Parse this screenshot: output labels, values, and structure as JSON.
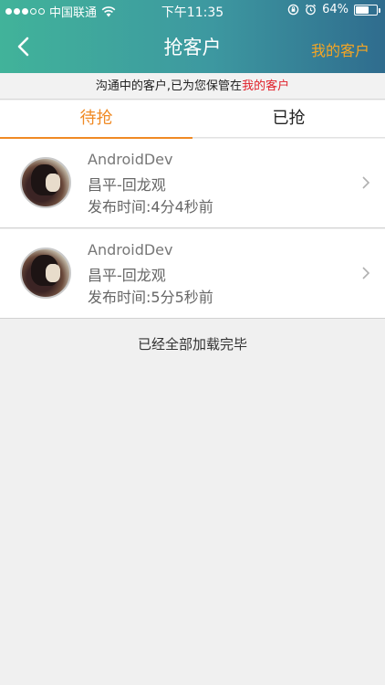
{
  "status_bar": {
    "carrier": "中国联通",
    "time": "下午11:35",
    "battery": "64%",
    "battery_level": 0.64
  },
  "nav": {
    "title": "抢客户",
    "right_label": "我的客户",
    "back_icon": "chevron-left-icon"
  },
  "notice": {
    "prefix": "沟通中的客户,已为您保管在",
    "link": "我的客户"
  },
  "tabs": [
    {
      "label": "待抢",
      "active": true
    },
    {
      "label": "已抢",
      "active": false
    }
  ],
  "customers": [
    {
      "name": "AndroidDev",
      "location": "昌平-回龙观",
      "publish_time": "发布时间:4分4秒前"
    },
    {
      "name": "AndroidDev",
      "location": "昌平-回龙观",
      "publish_time": "发布时间:5分5秒前"
    }
  ],
  "list_end": "已经全部加载完毕",
  "colors": {
    "header_start": "#41b39a",
    "header_end": "#2f6c8e",
    "accent_orange": "#f08a24",
    "nav_right": "#f7a623",
    "notice_highlight": "#e0202a"
  }
}
